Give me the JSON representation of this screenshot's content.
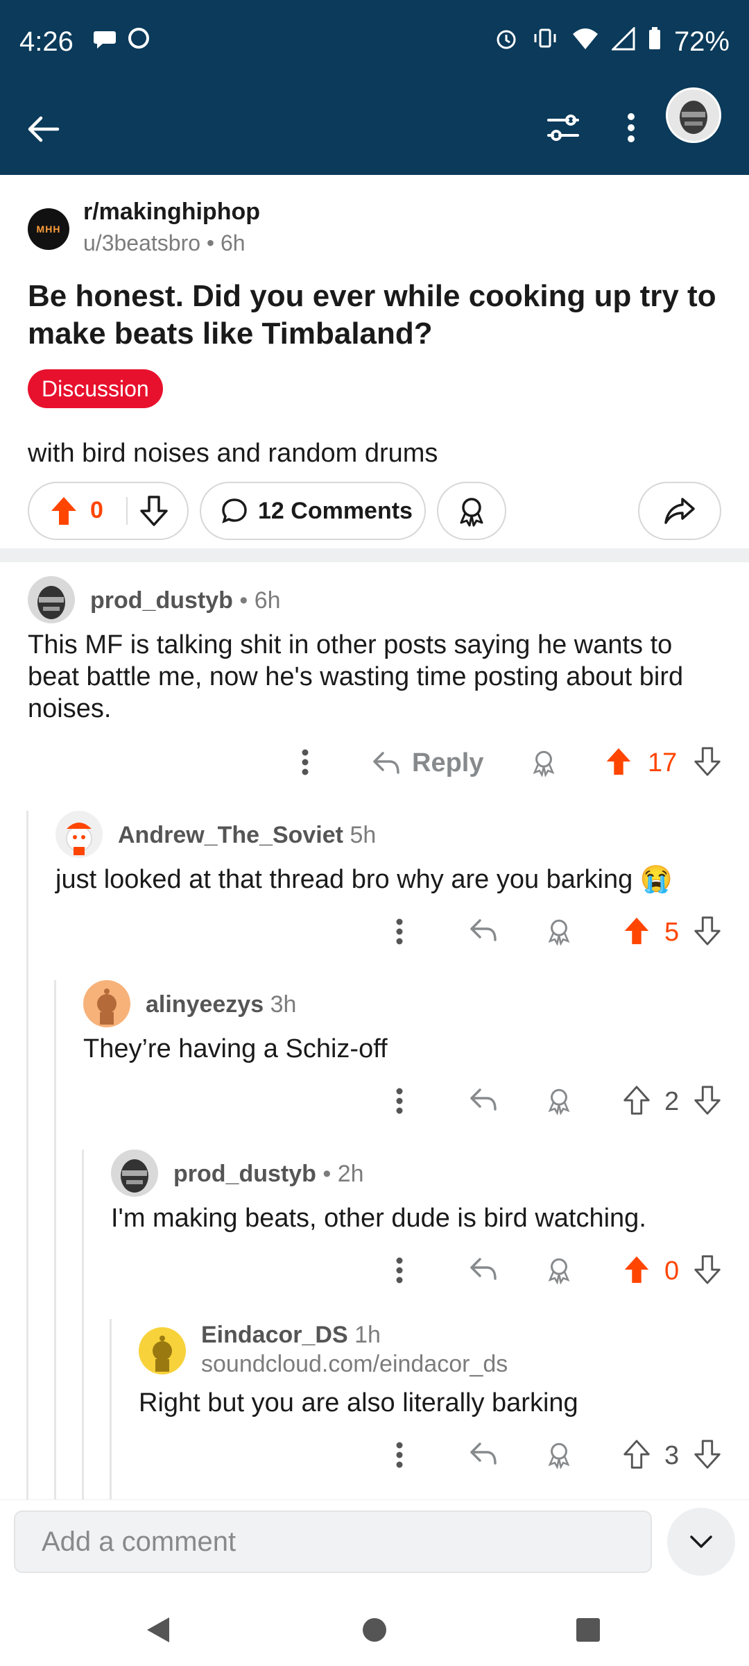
{
  "status": {
    "time": "4:26",
    "battery": "72%"
  },
  "post": {
    "subreddit": "r/makinghiphop",
    "sub_avatar_text": "MHH",
    "author": "u/3beatsbro",
    "age": "6h",
    "title": "Be honest. Did you ever while cooking up try to make beats like Timbaland?",
    "flair": "Discussion",
    "body": "with bird noises and random drums",
    "score": "0",
    "comments_label": "12 Comments"
  },
  "comments": [
    {
      "user": "prod_dustyb",
      "time": "• 6h",
      "text": "This MF is talking shit in other posts saying he wants to beat battle me, now he's wasting time posting about bird noises.",
      "reply_label": "Reply",
      "score": "17"
    },
    {
      "user": "Andrew_The_Soviet",
      "time": "5h",
      "text": "just looked at that thread bro why are you barking 😭",
      "score": "5"
    },
    {
      "user": "alinyeezys",
      "time": "3h",
      "text": "They’re having a Schiz-off",
      "score": "2"
    },
    {
      "user": "prod_dustyb",
      "time": "• 2h",
      "text": "I'm making beats, other dude is bird watching.",
      "score": "0"
    },
    {
      "user": "Eindacor_DS",
      "time": "1h",
      "link": "soundcloud.com/eindacor_ds",
      "text": "Right but you are also literally barking",
      "score": "3"
    }
  ],
  "composer": {
    "placeholder": "Add a comment"
  },
  "colors": {
    "header": "#0b3a5a",
    "upvote": "#ff4500",
    "flair": "#e8112d"
  }
}
